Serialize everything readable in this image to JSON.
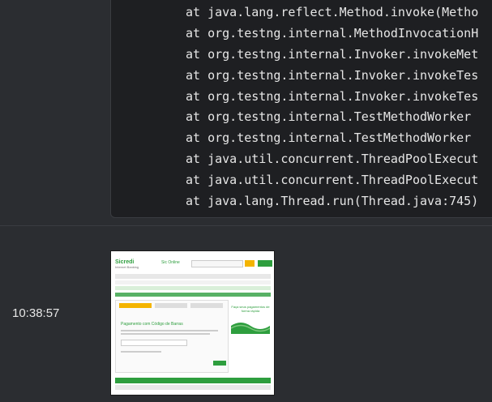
{
  "code_block": {
    "lines": [
      "at java.lang.reflect.Method.invoke(Metho",
      "at org.testng.internal.MethodInvocationH",
      "at org.testng.internal.Invoker.invokeMet",
      "at org.testng.internal.Invoker.invokeTes",
      "at org.testng.internal.Invoker.invokeTes",
      "at org.testng.internal.TestMethodWorker",
      "at org.testng.internal.TestMethodWorker",
      "at java.util.concurrent.ThreadPoolExecut",
      "at java.util.concurrent.ThreadPoolExecut",
      "at java.lang.Thread.run(Thread.java:745)"
    ]
  },
  "message": {
    "timestamp": "10:38:57",
    "attachment": {
      "logo_text": "Sicredi",
      "logo_subtext": "Internet Banking",
      "online_text": "Sic Online",
      "page_heading": "Pagamento com Código de Barras",
      "side_text": "Faça seus pagamentos de forma rápida",
      "colors": {
        "brand_green": "#2e9e3e",
        "brand_yellow": "#f4b400"
      }
    }
  }
}
